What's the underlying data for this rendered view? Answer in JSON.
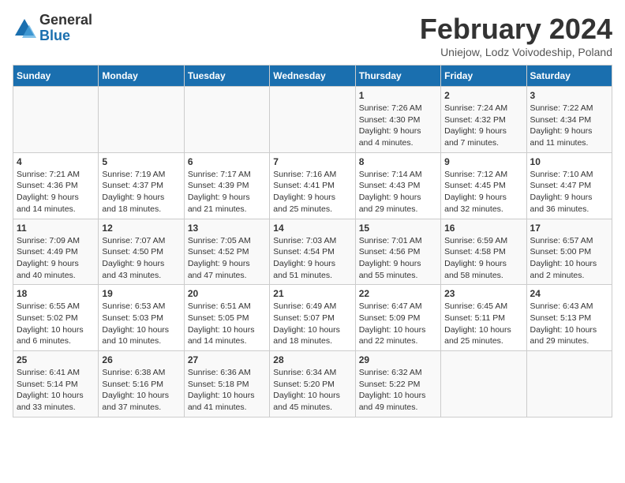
{
  "header": {
    "logo_line1": "General",
    "logo_line2": "Blue",
    "title": "February 2024",
    "subtitle": "Uniejow, Lodz Voivodeship, Poland"
  },
  "columns": [
    "Sunday",
    "Monday",
    "Tuesday",
    "Wednesday",
    "Thursday",
    "Friday",
    "Saturday"
  ],
  "weeks": [
    [
      {
        "day": "",
        "info": ""
      },
      {
        "day": "",
        "info": ""
      },
      {
        "day": "",
        "info": ""
      },
      {
        "day": "",
        "info": ""
      },
      {
        "day": "1",
        "info": "Sunrise: 7:26 AM\nSunset: 4:30 PM\nDaylight: 9 hours\nand 4 minutes."
      },
      {
        "day": "2",
        "info": "Sunrise: 7:24 AM\nSunset: 4:32 PM\nDaylight: 9 hours\nand 7 minutes."
      },
      {
        "day": "3",
        "info": "Sunrise: 7:22 AM\nSunset: 4:34 PM\nDaylight: 9 hours\nand 11 minutes."
      }
    ],
    [
      {
        "day": "4",
        "info": "Sunrise: 7:21 AM\nSunset: 4:36 PM\nDaylight: 9 hours\nand 14 minutes."
      },
      {
        "day": "5",
        "info": "Sunrise: 7:19 AM\nSunset: 4:37 PM\nDaylight: 9 hours\nand 18 minutes."
      },
      {
        "day": "6",
        "info": "Sunrise: 7:17 AM\nSunset: 4:39 PM\nDaylight: 9 hours\nand 21 minutes."
      },
      {
        "day": "7",
        "info": "Sunrise: 7:16 AM\nSunset: 4:41 PM\nDaylight: 9 hours\nand 25 minutes."
      },
      {
        "day": "8",
        "info": "Sunrise: 7:14 AM\nSunset: 4:43 PM\nDaylight: 9 hours\nand 29 minutes."
      },
      {
        "day": "9",
        "info": "Sunrise: 7:12 AM\nSunset: 4:45 PM\nDaylight: 9 hours\nand 32 minutes."
      },
      {
        "day": "10",
        "info": "Sunrise: 7:10 AM\nSunset: 4:47 PM\nDaylight: 9 hours\nand 36 minutes."
      }
    ],
    [
      {
        "day": "11",
        "info": "Sunrise: 7:09 AM\nSunset: 4:49 PM\nDaylight: 9 hours\nand 40 minutes."
      },
      {
        "day": "12",
        "info": "Sunrise: 7:07 AM\nSunset: 4:50 PM\nDaylight: 9 hours\nand 43 minutes."
      },
      {
        "day": "13",
        "info": "Sunrise: 7:05 AM\nSunset: 4:52 PM\nDaylight: 9 hours\nand 47 minutes."
      },
      {
        "day": "14",
        "info": "Sunrise: 7:03 AM\nSunset: 4:54 PM\nDaylight: 9 hours\nand 51 minutes."
      },
      {
        "day": "15",
        "info": "Sunrise: 7:01 AM\nSunset: 4:56 PM\nDaylight: 9 hours\nand 55 minutes."
      },
      {
        "day": "16",
        "info": "Sunrise: 6:59 AM\nSunset: 4:58 PM\nDaylight: 9 hours\nand 58 minutes."
      },
      {
        "day": "17",
        "info": "Sunrise: 6:57 AM\nSunset: 5:00 PM\nDaylight: 10 hours\nand 2 minutes."
      }
    ],
    [
      {
        "day": "18",
        "info": "Sunrise: 6:55 AM\nSunset: 5:02 PM\nDaylight: 10 hours\nand 6 minutes."
      },
      {
        "day": "19",
        "info": "Sunrise: 6:53 AM\nSunset: 5:03 PM\nDaylight: 10 hours\nand 10 minutes."
      },
      {
        "day": "20",
        "info": "Sunrise: 6:51 AM\nSunset: 5:05 PM\nDaylight: 10 hours\nand 14 minutes."
      },
      {
        "day": "21",
        "info": "Sunrise: 6:49 AM\nSunset: 5:07 PM\nDaylight: 10 hours\nand 18 minutes."
      },
      {
        "day": "22",
        "info": "Sunrise: 6:47 AM\nSunset: 5:09 PM\nDaylight: 10 hours\nand 22 minutes."
      },
      {
        "day": "23",
        "info": "Sunrise: 6:45 AM\nSunset: 5:11 PM\nDaylight: 10 hours\nand 25 minutes."
      },
      {
        "day": "24",
        "info": "Sunrise: 6:43 AM\nSunset: 5:13 PM\nDaylight: 10 hours\nand 29 minutes."
      }
    ],
    [
      {
        "day": "25",
        "info": "Sunrise: 6:41 AM\nSunset: 5:14 PM\nDaylight: 10 hours\nand 33 minutes."
      },
      {
        "day": "26",
        "info": "Sunrise: 6:38 AM\nSunset: 5:16 PM\nDaylight: 10 hours\nand 37 minutes."
      },
      {
        "day": "27",
        "info": "Sunrise: 6:36 AM\nSunset: 5:18 PM\nDaylight: 10 hours\nand 41 minutes."
      },
      {
        "day": "28",
        "info": "Sunrise: 6:34 AM\nSunset: 5:20 PM\nDaylight: 10 hours\nand 45 minutes."
      },
      {
        "day": "29",
        "info": "Sunrise: 6:32 AM\nSunset: 5:22 PM\nDaylight: 10 hours\nand 49 minutes."
      },
      {
        "day": "",
        "info": ""
      },
      {
        "day": "",
        "info": ""
      }
    ]
  ]
}
